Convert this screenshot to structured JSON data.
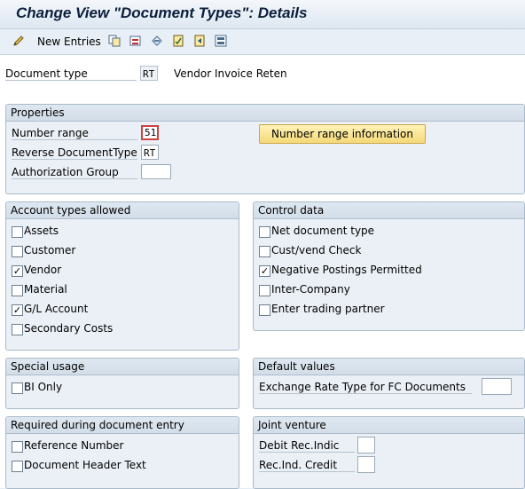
{
  "header": {
    "title": "Change View \"Document Types\": Details"
  },
  "toolbar": {
    "new_entries": "New Entries"
  },
  "doc": {
    "label": "Document type",
    "code": "RT",
    "description": "Vendor Invoice Reten"
  },
  "properties": {
    "title": "Properties",
    "number_range_label": "Number range",
    "number_range_value": "51",
    "reverse_label": "Reverse DocumentType",
    "reverse_value": "RT",
    "auth_label": "Authorization Group",
    "auth_value": "",
    "nr_info_button": "Number range information"
  },
  "account_types": {
    "title": "Account types allowed",
    "items": [
      {
        "label": "Assets",
        "checked": false
      },
      {
        "label": "Customer",
        "checked": false
      },
      {
        "label": "Vendor",
        "checked": true
      },
      {
        "label": "Material",
        "checked": false
      },
      {
        "label": "G/L Account",
        "checked": true
      },
      {
        "label": "Secondary Costs",
        "checked": false
      }
    ]
  },
  "control_data": {
    "title": "Control data",
    "items": [
      {
        "label": "Net document type",
        "checked": false
      },
      {
        "label": "Cust/vend Check",
        "checked": false
      },
      {
        "label": "Negative Postings Permitted",
        "checked": true
      },
      {
        "label": "Inter-Company",
        "checked": false
      },
      {
        "label": "Enter trading partner",
        "checked": false
      }
    ]
  },
  "special_usage": {
    "title": "Special usage",
    "bi_only": "BI Only",
    "bi_only_checked": false
  },
  "default_values": {
    "title": "Default values",
    "exrate_label": "Exchange Rate Type for FC Documents",
    "exrate_value": ""
  },
  "required_entry": {
    "title": "Required during document entry",
    "items": [
      {
        "label": "Reference Number",
        "checked": false
      },
      {
        "label": "Document Header Text",
        "checked": false
      }
    ]
  },
  "joint_venture": {
    "title": "Joint venture",
    "debit_label": "Debit Rec.Indic",
    "debit_value": "",
    "credit_label": "Rec.Ind. Credit",
    "credit_value": ""
  },
  "checkmark": "✓"
}
